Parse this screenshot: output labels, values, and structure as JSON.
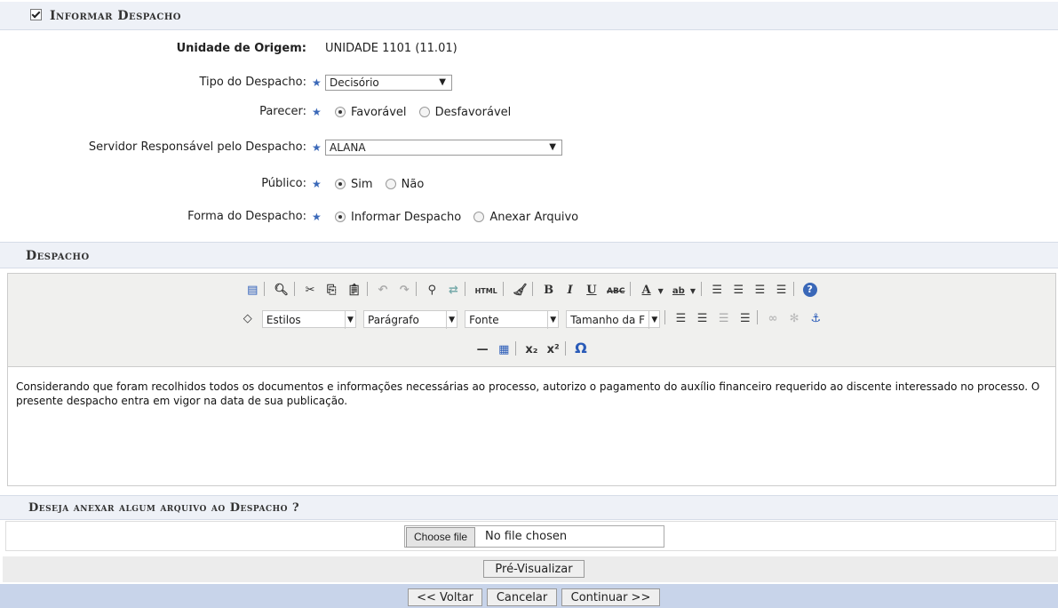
{
  "section_informar": "Informar Despacho",
  "unidade_origem": {
    "label": "Unidade de Origem:",
    "value": "UNIDADE 1101 (11.01)"
  },
  "tipo_despacho": {
    "label": "Tipo do Despacho:",
    "value": "Decisório"
  },
  "parecer": {
    "label": "Parecer:",
    "options": [
      "Favorável",
      "Desfavorável"
    ],
    "selected": "Favorável"
  },
  "servidor": {
    "label": "Servidor Responsável pelo Despacho:",
    "value": "ALANA"
  },
  "publico": {
    "label": "Público:",
    "options": [
      "Sim",
      "Não"
    ],
    "selected": "Sim"
  },
  "forma_despacho": {
    "label": "Forma do Despacho:",
    "options": [
      "Informar Despacho",
      "Anexar Arquivo"
    ],
    "selected": "Informar Despacho"
  },
  "section_despacho": "Despacho",
  "editor": {
    "dropdowns": {
      "styles": "Estilos",
      "paragraph": "Parágrafo",
      "font": "Fonte",
      "size": "Tamanho da F"
    },
    "content": "Considerando que foram recolhidos todos os documentos e informações necessárias ao processo, autorizo o pagamento do auxílio financeiro requerido ao discente interessado no processo. O presente despacho entra em vigor na data de sua publicação."
  },
  "section_anexar": "Deseja anexar algum arquivo ao Despacho ?",
  "file_input": {
    "button": "Choose file",
    "status": "No file chosen"
  },
  "buttons": {
    "preview": "Pré-Visualizar",
    "back": "<< Voltar",
    "cancel": "Cancelar",
    "continue": "Continuar >>"
  },
  "colors": {
    "required_star": "#3a68b8",
    "section_bg": "#eef1f7",
    "footer_bg": "#c8d4ea"
  }
}
